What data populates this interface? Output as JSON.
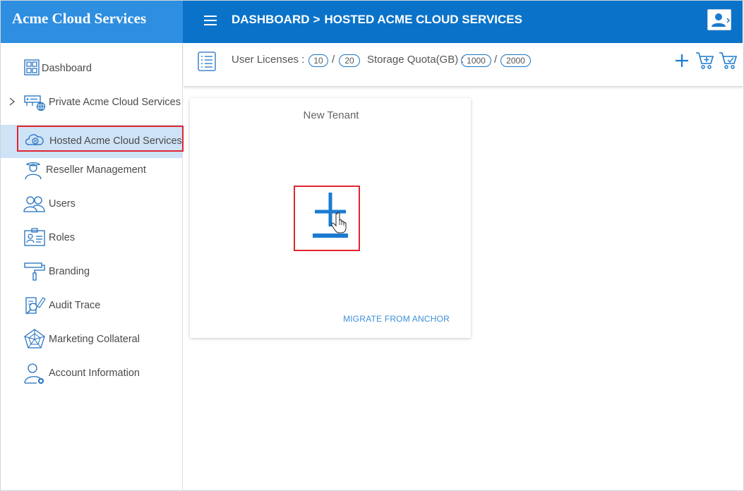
{
  "header": {
    "brand": "Acme Cloud Services",
    "breadcrumb": {
      "root": "DASHBOARD",
      "separator": ">",
      "current": "HOSTED ACME CLOUD SERVICES"
    }
  },
  "sidebar": {
    "items": [
      {
        "label": "Dashboard",
        "icon": "dashboard-grid-icon"
      },
      {
        "label": "Private Acme Cloud Services",
        "icon": "server-globe-icon",
        "expandable": true
      },
      {
        "label": "Hosted Acme Cloud Services",
        "icon": "cloud-icon",
        "active": true
      },
      {
        "label": "Reseller Management",
        "icon": "reseller-person-icon"
      },
      {
        "label": "Users",
        "icon": "users-icon"
      },
      {
        "label": "Roles",
        "icon": "id-card-icon"
      },
      {
        "label": "Branding",
        "icon": "paint-roller-icon"
      },
      {
        "label": "Audit Trace",
        "icon": "audit-magnifier-icon"
      },
      {
        "label": "Marketing Collateral",
        "icon": "spider-web-icon"
      },
      {
        "label": "Account Information",
        "icon": "account-settings-icon"
      }
    ]
  },
  "toolbar": {
    "user_licenses_label": "User Licenses :",
    "user_licenses_used": "10",
    "user_licenses_total": "20",
    "storage_label": "Storage Quota(GB) :",
    "storage_used": "1000",
    "storage_total": "2000",
    "separator": "/"
  },
  "card": {
    "title": "New Tenant",
    "migrate_link": "MIGRATE FROM ANCHOR"
  },
  "colors": {
    "brand": "#2e8ee0",
    "topbar": "#0a73c9",
    "accent": "#1a7bd0",
    "active_bg": "#cfe3f7",
    "highlight": "#e02530"
  }
}
